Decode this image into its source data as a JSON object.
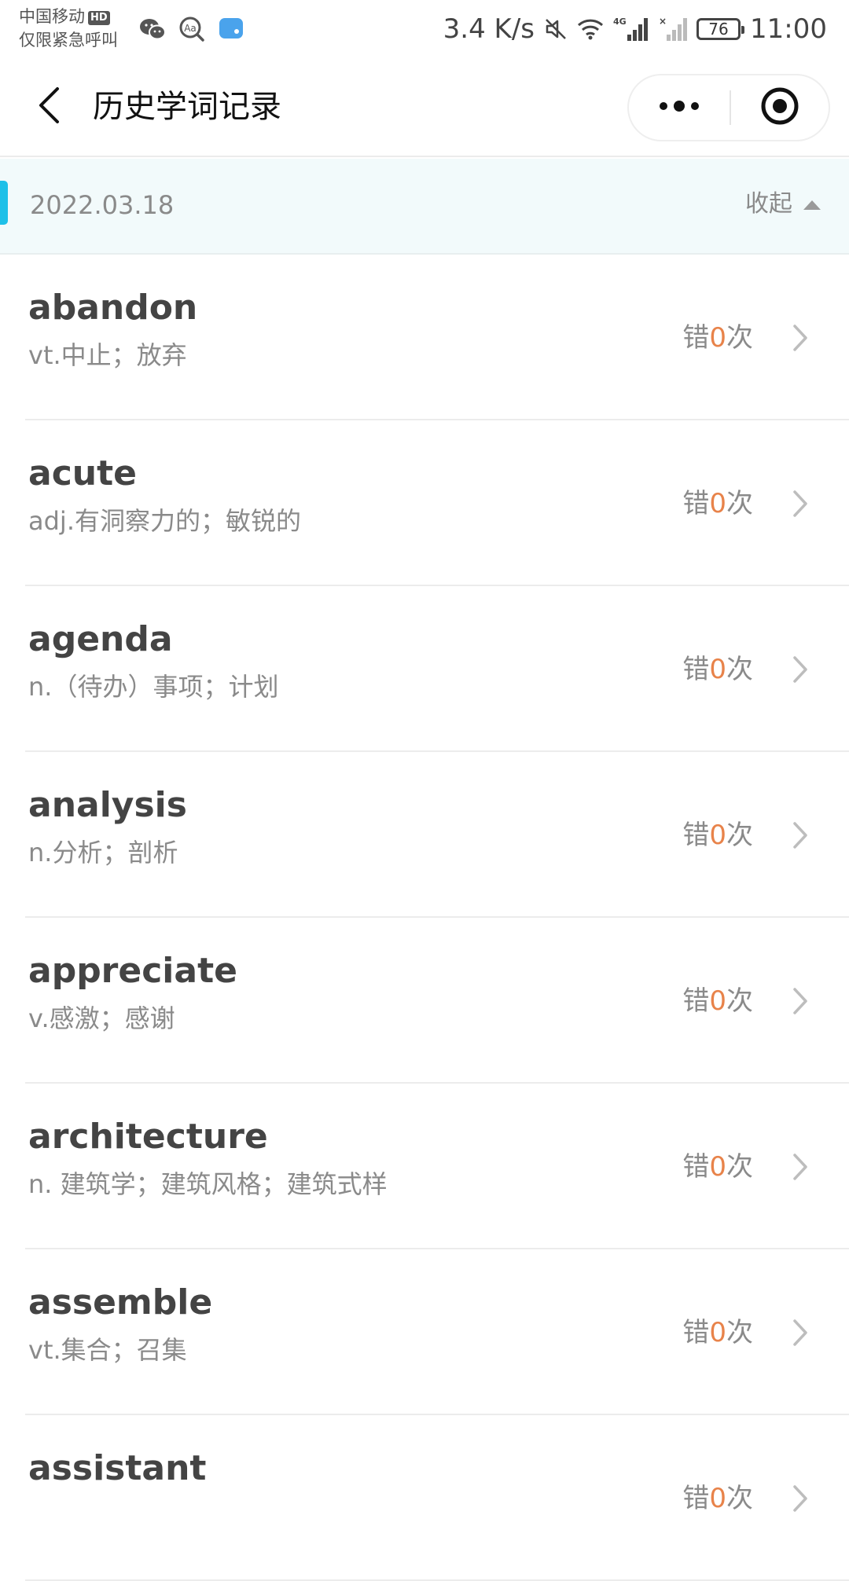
{
  "status_bar": {
    "carrier": "中国移动",
    "hd_badge": "HD",
    "emergency": "仅限紧急呼叫",
    "net_speed": "3.4 K/s",
    "signal_label": "4G",
    "battery": "76",
    "time": "11:00",
    "icons": [
      "wechat-icon",
      "search-aa-icon",
      "message-app-icon",
      "mute-icon",
      "wifi-icon",
      "signal-4g-icon",
      "signal-no-sim-icon",
      "battery-icon"
    ]
  },
  "nav": {
    "title": "历史学词记录",
    "icons": [
      "back-arrow-icon",
      "more-dots-icon",
      "close-target-icon"
    ]
  },
  "group": {
    "date": "2022.03.18",
    "collapse_label": "收起",
    "accent_color": "#1ec0e8"
  },
  "words": [
    {
      "word": "abandon",
      "meaning": "vt.中止；放弃",
      "err_prefix": "错",
      "err_count": "0",
      "err_suffix": "次"
    },
    {
      "word": "acute",
      "meaning": "adj.有洞察力的；敏锐的",
      "err_prefix": "错",
      "err_count": "0",
      "err_suffix": "次"
    },
    {
      "word": "agenda",
      "meaning": "n.（待办）事项；计划",
      "err_prefix": "错",
      "err_count": "0",
      "err_suffix": "次"
    },
    {
      "word": "analysis",
      "meaning": "n.分析；剖析",
      "err_prefix": "错",
      "err_count": "0",
      "err_suffix": "次"
    },
    {
      "word": "appreciate",
      "meaning": "v.感激；感谢",
      "err_prefix": "错",
      "err_count": "0",
      "err_suffix": "次"
    },
    {
      "word": "architecture",
      "meaning": "n. 建筑学；建筑风格；建筑式样",
      "err_prefix": "错",
      "err_count": "0",
      "err_suffix": "次"
    },
    {
      "word": "assemble",
      "meaning": "vt.集合；召集",
      "err_prefix": "错",
      "err_count": "0",
      "err_suffix": "次"
    },
    {
      "word": "assistant",
      "meaning": "",
      "err_prefix": "错",
      "err_count": "0",
      "err_suffix": "次"
    }
  ],
  "colors": {
    "error_count": "#e8834a",
    "muted_text": "#8a8a8a",
    "word_text": "#444444"
  }
}
